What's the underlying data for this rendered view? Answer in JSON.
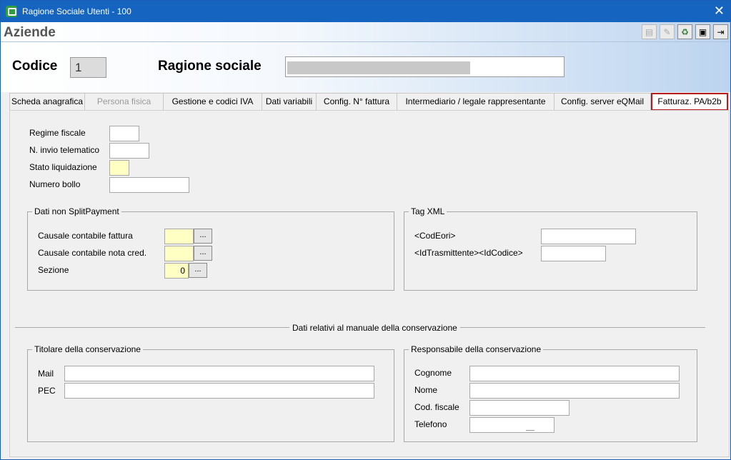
{
  "window": {
    "title": "Ragione Sociale Utenti - 100",
    "close_glyph": "✕"
  },
  "header": {
    "page_title": "Aziende",
    "codice_label": "Codice",
    "codice_value": "1",
    "ragione_label": "Ragione sociale"
  },
  "toolbar": {
    "buttons": [
      {
        "name": "report-icon",
        "glyph": "▤",
        "enabled": false
      },
      {
        "name": "edit-icon",
        "glyph": "✎",
        "enabled": false
      },
      {
        "name": "recycle-icon",
        "glyph": "♻",
        "enabled": true
      },
      {
        "name": "save-icon",
        "glyph": "▣",
        "enabled": true
      },
      {
        "name": "exit-icon",
        "glyph": "⇥",
        "enabled": true
      }
    ]
  },
  "tabs": [
    {
      "label": "Scheda anagrafica",
      "state": "normal"
    },
    {
      "label": "Persona fisica",
      "state": "disabled"
    },
    {
      "label": "Gestione e codici IVA",
      "state": "normal"
    },
    {
      "label": "Dati variabili",
      "state": "normal"
    },
    {
      "label": "Config. N° fattura",
      "state": "normal"
    },
    {
      "label": "Intermediario / legale rappresentante",
      "state": "normal"
    },
    {
      "label": "Config. server eQMail",
      "state": "normal"
    },
    {
      "label": "Fatturaz. PA/b2b",
      "state": "active"
    }
  ],
  "fatturazione": {
    "regime_fiscale_label": "Regime fiscale",
    "invio_telematico_label": "N. invio telematico",
    "stato_liquidazione_label": "Stato liquidazione",
    "numero_bollo_label": "Numero bollo",
    "split_group": {
      "legend": "Dati non SplitPayment",
      "causale_fattura_label": "Causale contabile fattura",
      "causale_nota_label": "Causale contabile nota cred.",
      "sezione_label": "Sezione",
      "sezione_value": "0",
      "lookup_button_label": "..."
    },
    "xml_group": {
      "legend": "Tag XML",
      "codeori_label": "<CodEori>",
      "idtrasm_label": "<IdTrasmittente><IdCodice>"
    },
    "conservazione_title": "Dati relativi al manuale della conservazione",
    "titolare_group": {
      "legend": "Titolare della conservazione",
      "mail_label": "Mail",
      "pec_label": "PEC"
    },
    "responsabile_group": {
      "legend": "Responsabile della conservazione",
      "cognome_label": "Cognome",
      "nome_label": "Nome",
      "codfiscale_label": "Cod. fiscale",
      "telefono_label": "Telefono"
    }
  },
  "colors": {
    "titlebar": "#1565c0",
    "highlight_field": "#ffffc4",
    "active_tab_border": "#b71c1c"
  }
}
